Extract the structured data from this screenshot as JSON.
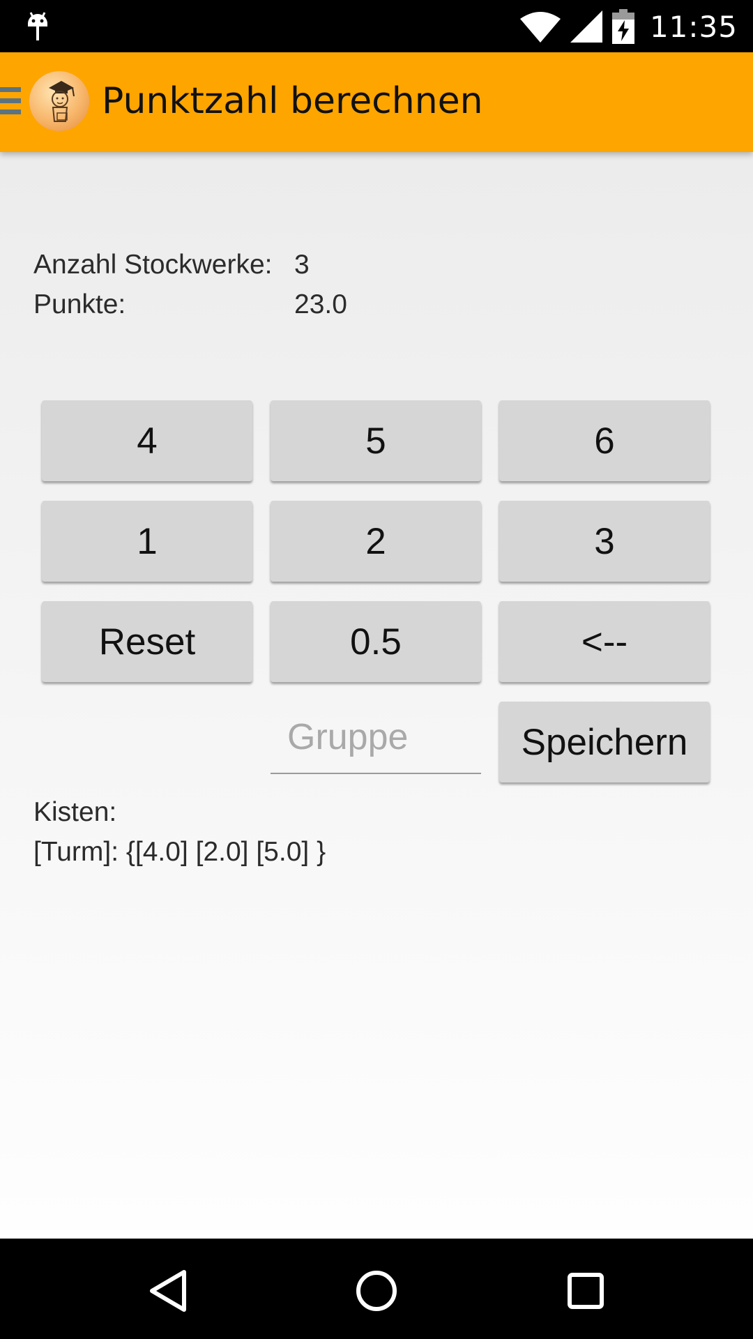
{
  "status": {
    "time": "11:35"
  },
  "app": {
    "title": "Punktzahl berechnen"
  },
  "info": {
    "floors_label": "Anzahl Stockwerke:",
    "floors_value": "3",
    "points_label": "Punkte:",
    "points_value": "23.0"
  },
  "keypad": {
    "k4": "4",
    "k5": "5",
    "k6": "6",
    "k1": "1",
    "k2": "2",
    "k3": "3",
    "reset": "Reset",
    "half": "0.5",
    "back": "<--"
  },
  "group": {
    "placeholder": "Gruppe",
    "value": ""
  },
  "save_label": "Speichern",
  "boxes": {
    "label": "Kisten:",
    "list": "[Turm]: {[4.0] [2.0] [5.0] }"
  }
}
